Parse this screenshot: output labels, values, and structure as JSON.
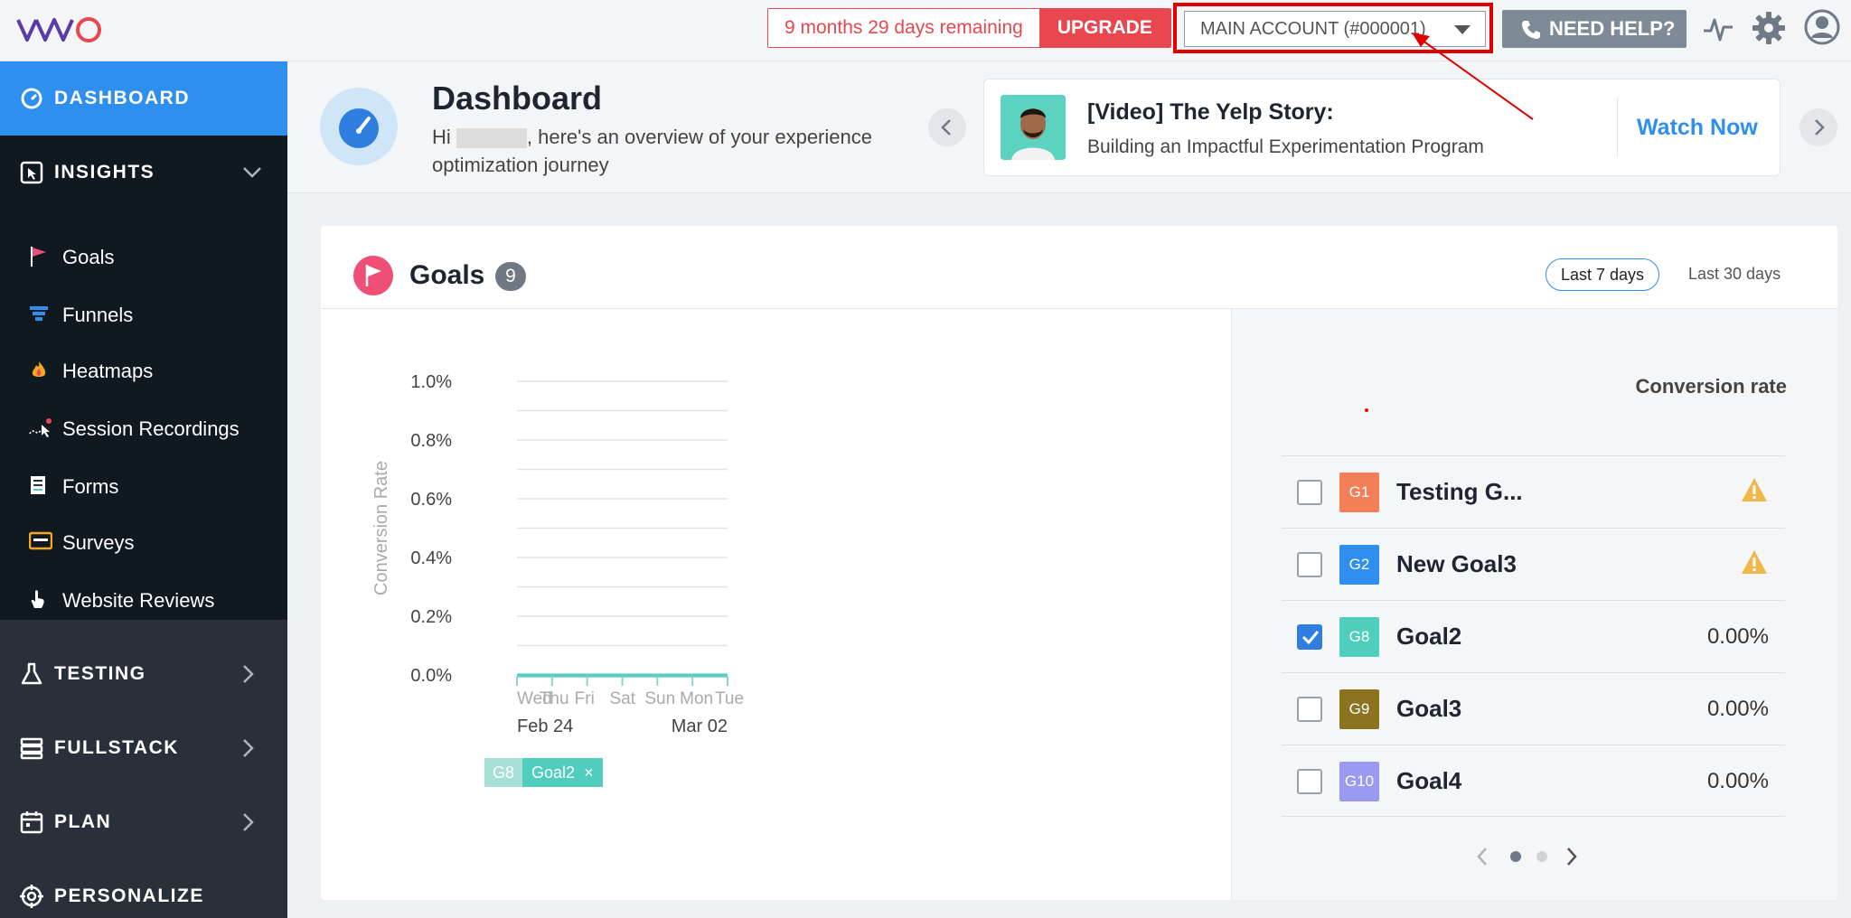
{
  "topbar": {
    "brand": "VWO",
    "trial_text": "9 months 29 days remaining",
    "upgrade_label": "UPGRADE",
    "account_label": "MAIN ACCOUNT (#000001)",
    "help_label": "NEED HELP?"
  },
  "sidebar": {
    "dashboard": "DASHBOARD",
    "insights": "INSIGHTS",
    "insights_items": [
      "Goals",
      "Funnels",
      "Heatmaps",
      "Session Recordings",
      "Forms",
      "Surveys",
      "Website Reviews"
    ],
    "sections": [
      "TESTING",
      "FULLSTACK",
      "PLAN",
      "PERSONALIZE"
    ]
  },
  "header": {
    "title": "Dashboard",
    "greeting_prefix": "Hi",
    "greeting_suffix": ", here's an overview of your experience optimization journey",
    "promo_title": "[Video] The Yelp Story:",
    "promo_subtitle": "Building an Impactful Experimentation Program",
    "promo_action": "Watch Now"
  },
  "goals": {
    "title": "Goals",
    "count": "9",
    "range_options": [
      "Last 7 days",
      "Last 30 days"
    ],
    "selected_range": "Last 7 days",
    "column_header": "Conversion rate",
    "rows": [
      {
        "badge": "G1",
        "name": "Testing G...",
        "value": "",
        "warning": true,
        "checked": false,
        "color": "#f47f57"
      },
      {
        "badge": "G2",
        "name": "New Goal3",
        "value": "",
        "warning": true,
        "checked": false,
        "color": "#2f8fee"
      },
      {
        "badge": "G8",
        "name": "Goal2",
        "value": "0.00%",
        "warning": false,
        "checked": true,
        "color": "#4fcdbd"
      },
      {
        "badge": "G9",
        "name": "Goal3",
        "value": "0.00%",
        "warning": false,
        "checked": false,
        "color": "#8b7320"
      },
      {
        "badge": "G10",
        "name": "Goal4",
        "value": "0.00%",
        "warning": false,
        "checked": false,
        "color": "#9a9bf0"
      }
    ],
    "legend": {
      "key": "G8",
      "label": "Goal2",
      "remove": "×"
    }
  },
  "chart_data": {
    "type": "line",
    "ylabel": "Conversion Rate",
    "y_ticks": [
      "1.0%",
      "0.8%",
      "0.6%",
      "0.4%",
      "0.2%",
      "0.0%"
    ],
    "ylim": [
      0,
      1.0
    ],
    "x": [
      "Wed",
      "Thu",
      "Fri",
      "Sat",
      "Sun",
      "Mon",
      "Tue"
    ],
    "x_dates": [
      "Feb 24",
      "Mar 02"
    ],
    "series": [
      {
        "name": "Goal2",
        "values": [
          0,
          0,
          0,
          0,
          0,
          0,
          0
        ],
        "color": "#4fcdbd"
      }
    ],
    "grid": true
  }
}
